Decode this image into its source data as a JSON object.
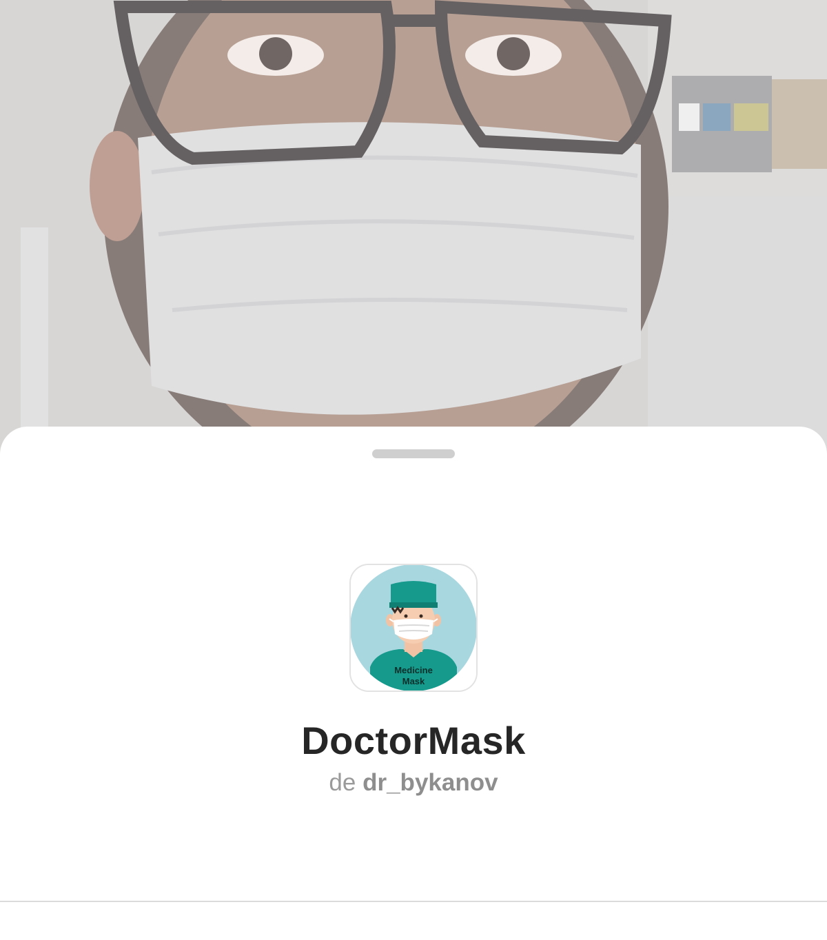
{
  "effect": {
    "title": "DoctorMask",
    "creator_prefix": "de",
    "creator_name": "dr_bykanov",
    "icon": {
      "name": "doctor-mask-icon",
      "label_line1": "Medicine",
      "label_line2": "Mask"
    }
  },
  "colors": {
    "sheet_background": "#ffffff",
    "title_color": "#262626",
    "subtitle_color": "#9a9a9a",
    "icon_circle": "#a9d7e0",
    "scrubs_teal": "#159a8c"
  }
}
